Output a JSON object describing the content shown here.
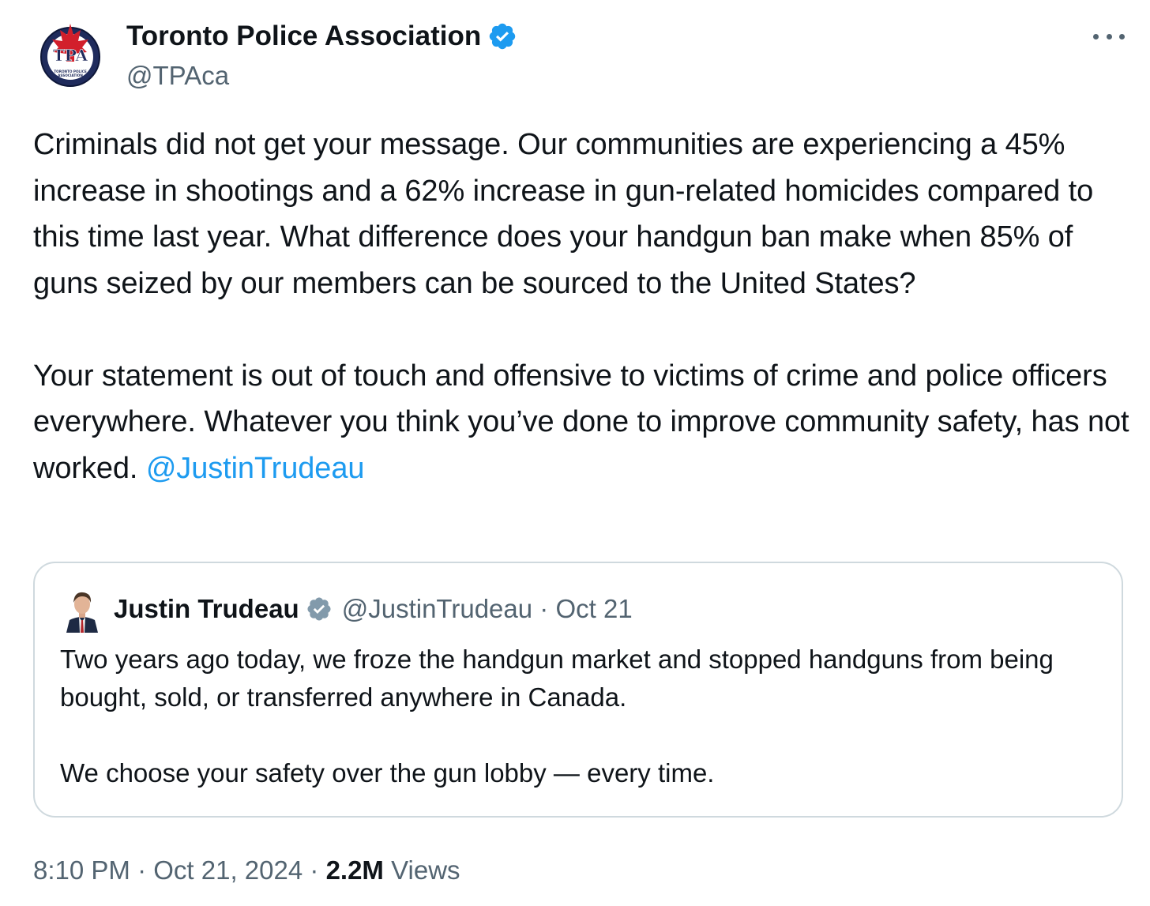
{
  "author": {
    "name": "Toronto Police Association",
    "handle": "@TPAca",
    "avatar_logo": {
      "letters": "TPA",
      "ring_text": "TORONTO POLICE ASSOCIATION"
    }
  },
  "menu": {
    "more_icon": "more-horizontal-icon"
  },
  "tweet": {
    "paragraph_1": "Criminals did not get your message. Our communities are experiencing a 45% increase in shootings and a 62% increase in gun-related homicides compared to this time last year. What difference does your handgun ban make when 85% of guns seized by our members can be sourced to the United States?",
    "paragraph_2": "Your statement is out of touch and offensive to victims of crime and police officers everywhere. Whatever you think you’ve done to improve community safety, has not worked.",
    "mention": "@JustinTrudeau"
  },
  "quoted": {
    "name": "Justin Trudeau",
    "handle": "@JustinTrudeau",
    "separator": "·",
    "date": "Oct 21",
    "paragraph_1": "Two years ago today, we froze the handgun market and stopped handguns from being bought, sold, or transferred anywhere in Canada.",
    "paragraph_2": "We choose your safety over the gun lobby — every time."
  },
  "meta": {
    "time": "8:10 PM",
    "separator": "·",
    "date": "Oct 21, 2024",
    "views_count": "2.2M",
    "views_label": "Views"
  },
  "colors": {
    "text": "#0f1419",
    "secondary": "#536471",
    "link": "#1d9bf0",
    "verified": "#1d9bf0",
    "verified_gray": "#829aab",
    "border": "#cfd9de"
  }
}
